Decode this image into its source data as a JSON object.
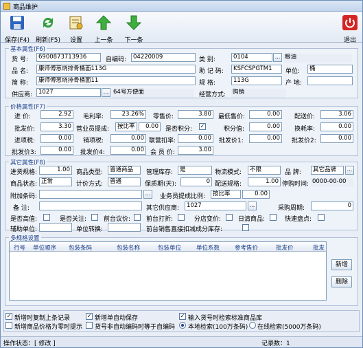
{
  "window": {
    "title": "商品维护"
  },
  "toolbar": {
    "save": "保存(F4)",
    "refresh": "刷新(F5)",
    "settings": "设置",
    "prev": "上一条",
    "next": "下一条",
    "exit": "退出"
  },
  "basic": {
    "title": "基本属性(F6)",
    "goods_no_label": "货  号:",
    "goods_no": "6900873713936",
    "self_code_label": "自编码:",
    "self_code": "04220009",
    "category_label": "类    别:",
    "category_code": "0104",
    "category_name": "粮油",
    "name_label": "品  名:",
    "name": "康师傅葱烧排骨桶面113G",
    "mnemonic_label": "助 记 码:",
    "mnemonic": "KSFCSPGTM1",
    "unit_label": "单位:",
    "unit": "桶",
    "short_label": "简  称:",
    "short": "康师傅葱烧排骨桶面11",
    "spec_label": "规    格:",
    "spec": "113G",
    "origin_label": "产  地:",
    "origin": "",
    "supplier_label": "供应商:",
    "supplier_code": "1027",
    "supplier_name": "64号方便面",
    "mode_label": "经营方式:",
    "mode": "购销"
  },
  "price": {
    "title": "价格属性(F7)",
    "buy_label": "进  价:",
    "buy": "2.92",
    "margin_label": "毛利率:",
    "margin": "23.26%",
    "retail_label": "零售价:",
    "retail": "3.80",
    "min_label": "最低售价:",
    "min": "0.00",
    "dist_label": "配送价:",
    "dist": "3.06",
    "wholesale_label": "批发价:",
    "wholesale": "3.30",
    "commission_label": "营业员提成:",
    "commission_type": "按比率",
    "commission": "0.00",
    "points_label": "是否积分:",
    "points_checked": "✓",
    "pointval_label": "积分值:",
    "pointval": "0.00",
    "exchange_label": "换耗率:",
    "exchange": "0.00",
    "intax_label": "进项税:",
    "intax": "0.00",
    "outtax_label": "销项税:",
    "outtax": "0.00",
    "joint_label": "联营扣率:",
    "joint": "0.00",
    "w1_label": "批发价1:",
    "w1": "0.00",
    "w2_label": "批发价2:",
    "w2": "0.00",
    "w3_label": "批发价3:",
    "w3": "0.00",
    "w4_label": "批发价4:",
    "w4": "0.00",
    "member_label": "会 员 价:",
    "member": "3.00"
  },
  "other": {
    "title": "其它属性(F8)",
    "inspec_label": "进货规格:",
    "inspec": "1.00",
    "type_label": "商品类型:",
    "type": "普通商品",
    "mgr_label": "管理库存:",
    "mgr": "是",
    "logistics_label": "物流模式:",
    "logistics": "不限",
    "brand_label": "品    牌:",
    "brand": "其它品牌",
    "status_label": "商品状态:",
    "status": "正常",
    "pricing_label": "计价方式:",
    "pricing": "普通",
    "shelf_label": "保质期(天):",
    "shelf": "0",
    "distspec_label": "配送规格:",
    "distspec": "1.00",
    "stoptime_label": "停购时间:",
    "stoptime": "0000-00-00",
    "barcode_label": "附加条码:",
    "barcode": "",
    "salecomm_label": "业务员提成比例:",
    "salecomm_type": "按比率",
    "salecomm": "0.00",
    "remark_label": "备  注:",
    "remark": "",
    "othersup_label": "其它供应商:",
    "othersup": "1027",
    "period_label": "采购周期:",
    "period": "0",
    "highfreq_label": "是否高值:",
    "focus_label": "是否关注:",
    "frontbargain_label": "前台议价:",
    "frontdiscount_label": "前台打折:",
    "branchprice_label": "分店变价:",
    "fresh_label": "日清商品:",
    "quickcount_label": "快速盘点:",
    "aux_label": "辅助单位:",
    "aux": "",
    "unitconv_label": "单位转换:",
    "unitconv": "",
    "frontsale_label": "前台销售直接扣减成分库存:"
  },
  "multi": {
    "title": "多规格设置",
    "headers": [
      "行号",
      "单位顺序",
      "包装条码",
      "包装名称",
      "包装单位",
      "单位系数",
      "参考售价",
      "批发价",
      "批发"
    ],
    "add": "新增",
    "delete": "删除"
  },
  "options": {
    "copy": "新增时复制上条记录",
    "autosave": "新增单自动保存",
    "zero": "新增商品价格为零时提示",
    "noauto": "货号非自动编码时等于自编码",
    "lookup": "输入货号时检索标准商品库",
    "local": "本地检索(100万条码)",
    "online": "在线检索(5000万条码)"
  },
  "status": {
    "op": "操作状态：[ 修改 ]",
    "count": "记录数：1"
  }
}
